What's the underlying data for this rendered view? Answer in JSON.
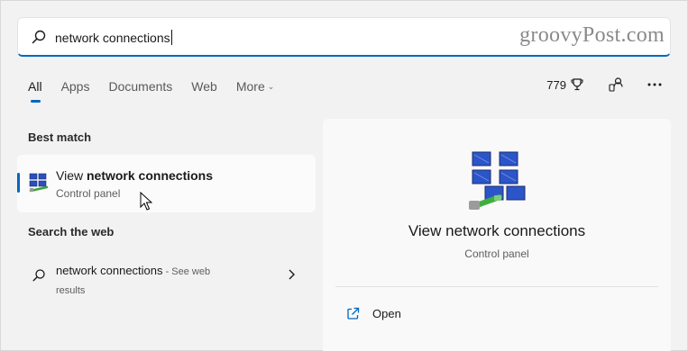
{
  "search": {
    "query": "network connections"
  },
  "watermark": "groovyPost.com",
  "tabs": [
    {
      "label": "All",
      "active": true
    },
    {
      "label": "Apps",
      "active": false
    },
    {
      "label": "Documents",
      "active": false
    },
    {
      "label": "Web",
      "active": false
    },
    {
      "label": "More",
      "active": false
    }
  ],
  "tools": {
    "points": "779",
    "icons": [
      "trophy-icon",
      "people-switch-icon",
      "more-options-icon"
    ]
  },
  "best_match": {
    "section_label": "Best match",
    "title_prefix": "View ",
    "title_bold": "network connections",
    "subtitle": "Control panel",
    "icon": "network-connections-icon"
  },
  "web_search": {
    "section_label": "Search the web",
    "query": "network connections",
    "hint": " - See web results"
  },
  "preview": {
    "title": "View network connections",
    "subtitle": "Control panel",
    "actions": [
      {
        "label": "Open",
        "icon": "open-external-icon"
      }
    ]
  },
  "colors": {
    "accent": "#0067c0",
    "background": "#f2f2f2",
    "card": "#fbfbfb"
  }
}
